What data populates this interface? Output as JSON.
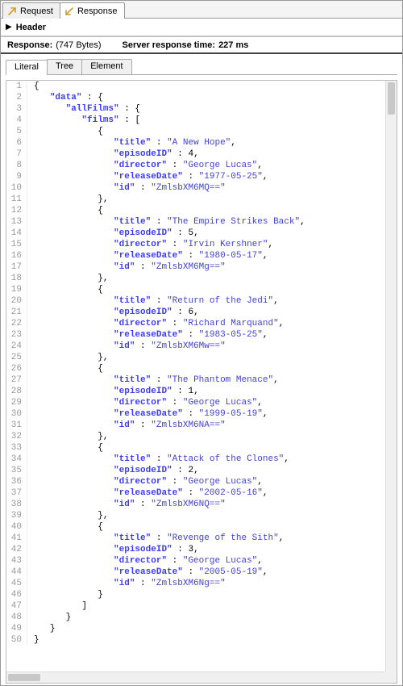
{
  "topTabs": {
    "request": "Request",
    "response": "Response"
  },
  "headerLabel": "Header",
  "info": {
    "responseLabel": "Response:",
    "sizeText": "(747 Bytes)",
    "serverTimeLabel": "Server response time:",
    "serverTimeValue": "227 ms"
  },
  "subTabs": {
    "literal": "Literal",
    "tree": "Tree",
    "element": "Element"
  },
  "json": {
    "data": {
      "allFilms": {
        "films": [
          {
            "title": "A New Hope",
            "episodeID": 4,
            "director": "George Lucas",
            "releaseDate": "1977-05-25",
            "id": "ZmlsbXM6MQ=="
          },
          {
            "title": "The Empire Strikes Back",
            "episodeID": 5,
            "director": "Irvin Kershner",
            "releaseDate": "1980-05-17",
            "id": "ZmlsbXM6Mg=="
          },
          {
            "title": "Return of the Jedi",
            "episodeID": 6,
            "director": "Richard Marquand",
            "releaseDate": "1983-05-25",
            "id": "ZmlsbXM6Mw=="
          },
          {
            "title": "The Phantom Menace",
            "episodeID": 1,
            "director": "George Lucas",
            "releaseDate": "1999-05-19",
            "id": "ZmlsbXM6NA=="
          },
          {
            "title": "Attack of the Clones",
            "episodeID": 2,
            "director": "George Lucas",
            "releaseDate": "2002-05-16",
            "id": "ZmlsbXM6NQ=="
          },
          {
            "title": "Revenge of the Sith",
            "episodeID": 3,
            "director": "George Lucas",
            "releaseDate": "2005-05-19",
            "id": "ZmlsbXM6Ng=="
          }
        ]
      }
    }
  },
  "lineCount": 50
}
